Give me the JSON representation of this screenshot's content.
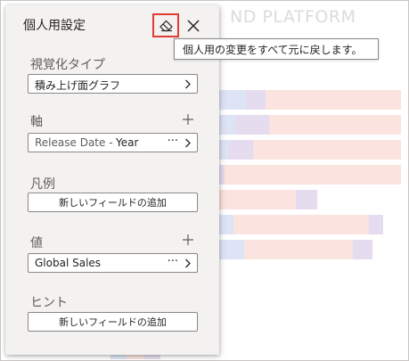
{
  "background": {
    "title_fragment": "ND PLATFORM"
  },
  "panel": {
    "title": "個人用設定",
    "eraser_icon": "eraser-icon",
    "close_icon": "close-icon",
    "tooltip": "個人用の変更をすべて元に戻します。",
    "visual_type": {
      "label": "視覚化タイプ",
      "value": "積み上げ面グラフ"
    },
    "axis": {
      "label": "軸",
      "field_name": "Release Date - ",
      "field_sub": "Year"
    },
    "legend": {
      "label": "凡例",
      "add_label": "新しいフィールドの追加"
    },
    "values": {
      "label": "値",
      "field_name": "Global Sales"
    },
    "tooltips": {
      "label": "ヒント",
      "add_label": "新しいフィールドの追加"
    },
    "more_label": "···"
  },
  "colors": {
    "panel_bg": "#f3f2f1",
    "highlight_border": "#e03c31",
    "bar_pink": "#fbe3df",
    "bar_blue": "#dde4f5",
    "bar_lilac": "#e6dcef"
  }
}
